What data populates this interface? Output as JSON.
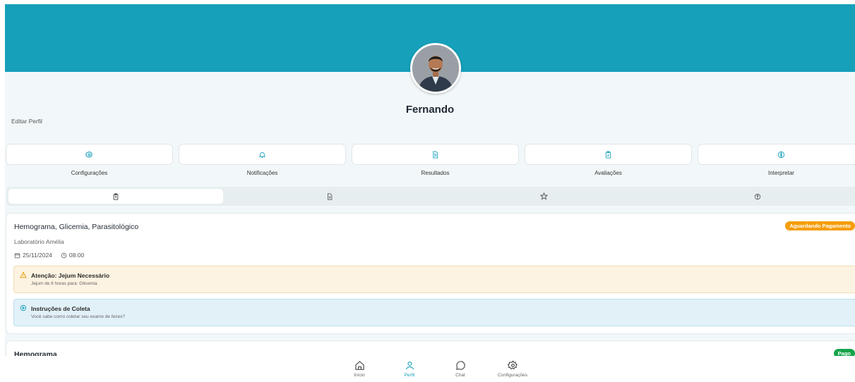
{
  "profile": {
    "name": "Fernando",
    "edit_label": "Editar Perfil"
  },
  "quick_actions": [
    {
      "label": "Configurações",
      "icon": "gear-icon"
    },
    {
      "label": "Notificações",
      "icon": "bell-icon"
    },
    {
      "label": "Resultados",
      "icon": "document-icon"
    },
    {
      "label": "Avaliações",
      "icon": "clipboard-check-icon"
    },
    {
      "label": "Interpretar",
      "icon": "brain-icon"
    }
  ],
  "tabs": [
    {
      "icon": "clipboard-icon",
      "active": true
    },
    {
      "icon": "document-icon",
      "active": false
    },
    {
      "icon": "star-icon",
      "active": false
    },
    {
      "icon": "brain-icon",
      "active": false
    }
  ],
  "exams": [
    {
      "title": "Hemograma, Glicemia, Parasitológico",
      "status": "Aguardando Pagamento",
      "lab": "Laboratório Amélia",
      "date": "25/11/2024",
      "time": "08:00",
      "warning": {
        "title": "Atenção: Jejum Necessário",
        "text": "Jejum de 8 horas para: Glicemia"
      },
      "instructions": {
        "title": "Instruções de Coleta",
        "text": "Você sabe como coletar seu exame de fezes?"
      }
    },
    {
      "title": "Hemograma",
      "status": "Pago"
    }
  ],
  "bottom_nav": [
    {
      "label": "Início",
      "icon": "home-icon",
      "active": false
    },
    {
      "label": "Perfil",
      "icon": "user-icon",
      "active": true
    },
    {
      "label": "Chat",
      "icon": "chat-icon",
      "active": false
    },
    {
      "label": "Configurações",
      "icon": "gear-icon",
      "active": false
    }
  ],
  "colors": {
    "primary": "#16a0ba",
    "warning_badge": "#f59e0b",
    "paid_badge": "#16a34a"
  }
}
